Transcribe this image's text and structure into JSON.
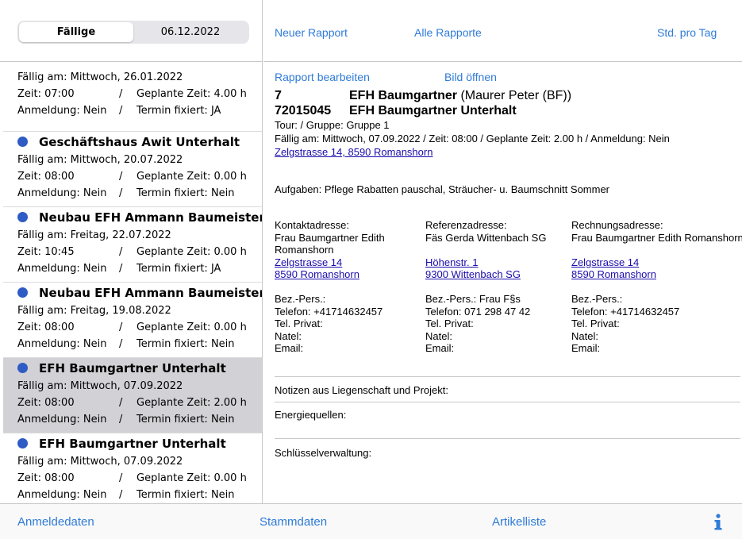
{
  "segmented": {
    "tab1": "Fällige",
    "tab2": "06.12.2022"
  },
  "list": {
    "partial": {
      "due": "Fällig am:  Mittwoch, 26.01.2022",
      "time": "Zeit: 07:00",
      "sep": "/",
      "planned": "Geplante Zeit: 4.00 h",
      "reg": "Anmeldung: Nein",
      "fixed": "Termin fixiert: JA"
    },
    "items": [
      {
        "title": "Geschäftshaus Awit Unterhalt",
        "due": "Fällig am:  Mittwoch, 20.07.2022",
        "time": "Zeit: 08:00",
        "sep": "/",
        "planned": "Geplante Zeit: 0.00 h",
        "reg": "Anmeldung: Nein",
        "fixed": "Termin fixiert: Nein"
      },
      {
        "title": "Neubau EFH Ammann Baumeisterarbe",
        "due": "Fällig am:  Freitag, 22.07.2022",
        "time": "Zeit: 10:45",
        "sep": "/",
        "planned": "Geplante Zeit: 0.00 h",
        "reg": "Anmeldung: Nein",
        "fixed": "Termin fixiert: JA"
      },
      {
        "title": "Neubau EFH Ammann Baumeisterarbe",
        "due": "Fällig am:  Freitag, 19.08.2022",
        "time": "Zeit: 08:00",
        "sep": "/",
        "planned": "Geplante Zeit: 0.00 h",
        "reg": "Anmeldung: Nein",
        "fixed": "Termin fixiert: Nein"
      },
      {
        "title": "EFH Baumgartner Unterhalt",
        "due": "Fällig am:  Mittwoch, 07.09.2022",
        "time": "Zeit: 08:00",
        "sep": "/",
        "planned": "Geplante Zeit: 2.00 h",
        "reg": "Anmeldung: Nein",
        "fixed": "Termin fixiert: Nein"
      },
      {
        "title": "EFH Baumgartner Unterhalt",
        "due": "Fällig am:  Mittwoch, 07.09.2022",
        "time": "Zeit: 08:00",
        "sep": "/",
        "planned": "Geplante Zeit: 0.00 h",
        "reg": "Anmeldung: Nein",
        "fixed": "Termin fixiert: Nein"
      }
    ]
  },
  "top_actions": {
    "new": "Neuer Rapport",
    "all": "Alle Rapporte",
    "std": "Std. pro Tag"
  },
  "detail": {
    "edit": "Rapport bearbeiten",
    "open_image": "Bild öffnen",
    "num1": "7",
    "name1": "EFH Baumgartner",
    "name1_extra": " (Maurer Peter (BF))",
    "num2": "72015045",
    "name2": "EFH Baumgartner Unterhalt",
    "tour": "Tour: / Gruppe: Gruppe 1",
    "due_line": "Fällig am: Mittwoch, 07.09.2022 / Zeit: 08:00 / Geplante Zeit: 2.00 h / Anmeldung: Nein",
    "address_link": "Zelgstrasse 14, 8590 Romanshorn",
    "tasks": "Aufgaben: Pflege Rabatten pauschal, Sträucher- u. Baumschnitt Sommer"
  },
  "contact": {
    "heading": "Kontaktadresse:",
    "name1": "Frau Baumgartner Edith",
    "name2": "Romanshorn",
    "street": "Zelgstrasse 14",
    "city": "8590 Romanshorn",
    "bez": "Bez.-Pers.:",
    "tel": "Telefon:  +41714632457",
    "priv": "Tel. Privat:",
    "natel": "Natel:",
    "email": "Email:"
  },
  "reference": {
    "heading": "Referenzadresse:",
    "name1": "Fäs Gerda Wittenbach SG",
    "street": "Höhenstr. 1",
    "city": "9300 Wittenbach SG",
    "bez": "Bez.-Pers.: Frau F§s",
    "tel": "Telefon:  071 298 47 42",
    "priv": "Tel. Privat:",
    "natel": "Natel:",
    "email": "Email:"
  },
  "billing": {
    "heading": "Rechnungsadresse:",
    "name1": "Frau Baumgartner Edith Romanshorn",
    "street": "Zelgstrasse 14",
    "city": "8590 Romanshorn",
    "bez": "Bez.-Pers.:",
    "tel": "Telefon:  +41714632457",
    "priv": "Tel. Privat:",
    "natel": "Natel:",
    "email": "Email:"
  },
  "notes": {
    "notes": "Notizen aus Liegenschaft und Projekt:",
    "energy": "Energiequellen:",
    "keys": "Schlüsselverwaltung:"
  },
  "bottom": {
    "tab1": "Anmeldedaten",
    "tab2": "Stammdaten",
    "tab3": "Artikelliste",
    "info_icon": "info-icon"
  }
}
